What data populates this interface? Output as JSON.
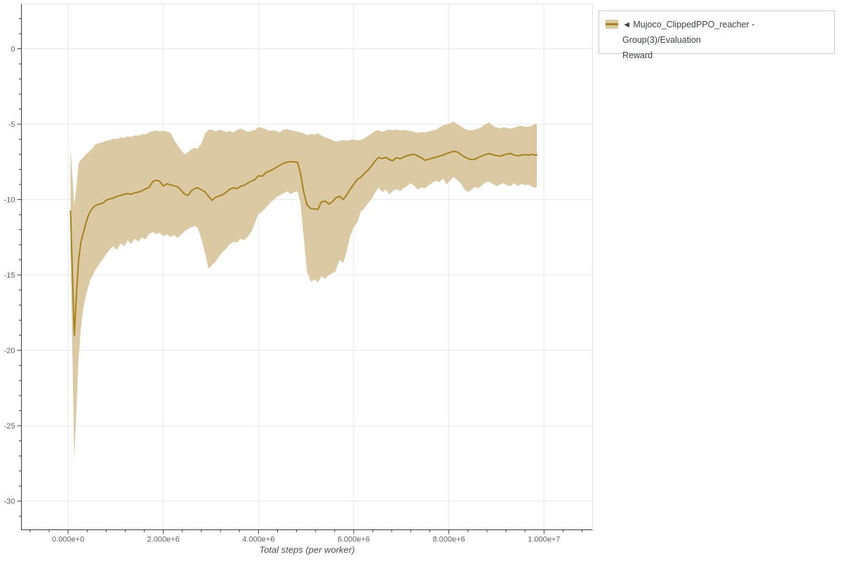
{
  "page": {
    "background": "#ffffff"
  },
  "legend": {
    "marker": "◄",
    "label_line1": "Mujoco_ClippedPPO_reacher - Group(3)/Evaluation",
    "label_line2": "Reward",
    "series_color": "#a9801e",
    "band_color": "#dac9a3",
    "border_color": "#c9c9c9"
  },
  "chart_data": {
    "type": "line",
    "title": "",
    "xlabel": "Total steps (per worker)",
    "ylabel": "",
    "x_unit": "steps",
    "xlim": [
      -982000,
      11020000
    ],
    "ylim": [
      -31.9,
      2.98
    ],
    "grid": "major",
    "legend_position": "outside-top-right",
    "x_ticks": {
      "values": [
        0,
        2000000,
        4000000,
        6000000,
        8000000,
        10000000
      ],
      "labels": [
        "0.000e+0",
        "2.000e+6",
        "4.000e+6",
        "6.000e+6",
        "8.000e+6",
        "1.000e+7"
      ],
      "minor_step": 400000
    },
    "y_ticks": {
      "values": [
        0,
        -5,
        -10,
        -15,
        -20,
        -25,
        -30
      ],
      "labels": [
        "0",
        "-5",
        "-10",
        "-15",
        "-20",
        "-25",
        "-30"
      ],
      "minor_step": 1
    },
    "style": {
      "grid_color": "#e7e7e7",
      "frame_outline_color": "#e5e5e5",
      "axis_color": "#3a3a3a",
      "tick_label_color": "#5f5f5f",
      "axis_label_color": "#4d4d4d"
    },
    "series": [
      {
        "name": "Mujoco_ClippedPPO_reacher - Group(3)/Evaluation Reward",
        "type": "line-with-band",
        "color": "#a9801e",
        "band_color": "#dac9a3",
        "x_scale_to_steps": 1000000,
        "x_millions": [
          0.05,
          0.13,
          0.18,
          0.22,
          0.27,
          0.32,
          0.37,
          0.42,
          0.47,
          0.52,
          0.57,
          0.65,
          0.72,
          0.8,
          0.88,
          0.95,
          1.02,
          1.1,
          1.18,
          1.25,
          1.32,
          1.4,
          1.48,
          1.55,
          1.62,
          1.7,
          1.78,
          1.85,
          1.92,
          2.0,
          2.08,
          2.15,
          2.22,
          2.3,
          2.38,
          2.45,
          2.52,
          2.58,
          2.65,
          2.72,
          2.8,
          2.88,
          2.95,
          3.02,
          3.1,
          3.18,
          3.25,
          3.32,
          3.4,
          3.48,
          3.55,
          3.62,
          3.7,
          3.78,
          3.85,
          3.92,
          4.0,
          4.08,
          4.15,
          4.22,
          4.3,
          4.38,
          4.45,
          4.52,
          4.6,
          4.68,
          4.75,
          4.82,
          4.88,
          4.95,
          5.02,
          5.1,
          5.18,
          5.25,
          5.32,
          5.4,
          5.48,
          5.55,
          5.62,
          5.7,
          5.78,
          5.85,
          5.92,
          6.0,
          6.08,
          6.15,
          6.22,
          6.3,
          6.38,
          6.45,
          6.52,
          6.6,
          6.68,
          6.75,
          6.82,
          6.9,
          6.98,
          7.05,
          7.12,
          7.2,
          7.28,
          7.35,
          7.42,
          7.5,
          7.58,
          7.65,
          7.72,
          7.8,
          7.88,
          7.95,
          8.02,
          8.1,
          8.18,
          8.25,
          8.32,
          8.4,
          8.48,
          8.55,
          8.62,
          8.7,
          8.78,
          8.85,
          8.92,
          9.0,
          9.08,
          9.15,
          9.22,
          9.3,
          9.38,
          9.45,
          9.52,
          9.6,
          9.68,
          9.75,
          9.82,
          9.85
        ],
        "mean": [
          -10.75,
          -19.0,
          -16.0,
          -14.0,
          -12.8,
          -12.2,
          -11.6,
          -11.1,
          -10.75,
          -10.55,
          -10.4,
          -10.3,
          -10.25,
          -10.05,
          -9.95,
          -9.9,
          -9.8,
          -9.72,
          -9.65,
          -9.6,
          -9.65,
          -9.55,
          -9.5,
          -9.42,
          -9.3,
          -9.2,
          -8.8,
          -8.72,
          -8.78,
          -9.1,
          -8.95,
          -9.02,
          -9.08,
          -9.15,
          -9.4,
          -9.65,
          -9.72,
          -9.45,
          -9.28,
          -9.22,
          -9.35,
          -9.5,
          -9.78,
          -10.05,
          -9.85,
          -9.75,
          -9.68,
          -9.52,
          -9.3,
          -9.22,
          -9.28,
          -9.12,
          -9.05,
          -8.9,
          -8.78,
          -8.68,
          -8.42,
          -8.45,
          -8.22,
          -8.12,
          -8.0,
          -7.85,
          -7.72,
          -7.6,
          -7.52,
          -7.48,
          -7.5,
          -7.52,
          -8.2,
          -9.5,
          -10.35,
          -10.6,
          -10.62,
          -10.65,
          -10.15,
          -10.1,
          -10.3,
          -10.15,
          -9.9,
          -9.78,
          -10.0,
          -9.7,
          -9.35,
          -9.0,
          -8.65,
          -8.52,
          -8.28,
          -8.05,
          -7.75,
          -7.45,
          -7.2,
          -7.28,
          -7.2,
          -7.35,
          -7.42,
          -7.22,
          -7.3,
          -7.18,
          -7.1,
          -7.02,
          -7.0,
          -7.12,
          -7.22,
          -7.4,
          -7.32,
          -7.25,
          -7.2,
          -7.12,
          -7.05,
          -6.95,
          -6.88,
          -6.8,
          -6.85,
          -7.0,
          -7.15,
          -7.28,
          -7.35,
          -7.32,
          -7.2,
          -7.1,
          -7.0,
          -6.95,
          -7.02,
          -7.08,
          -7.12,
          -7.05,
          -6.98,
          -6.95,
          -7.05,
          -7.1,
          -7.05,
          -7.02,
          -7.06,
          -7.0,
          -7.05,
          -7.05
        ],
        "band_upper": [
          -6.5,
          -10.4,
          -9.0,
          -7.6,
          -7.35,
          -7.2,
          -7.0,
          -6.9,
          -6.7,
          -6.6,
          -6.35,
          -6.25,
          -6.2,
          -6.1,
          -6.05,
          -5.95,
          -6.0,
          -5.88,
          -5.92,
          -5.8,
          -5.85,
          -5.72,
          -5.78,
          -5.65,
          -5.68,
          -5.55,
          -5.45,
          -5.42,
          -5.48,
          -5.42,
          -5.5,
          -5.58,
          -6.0,
          -6.4,
          -6.75,
          -7.0,
          -6.85,
          -6.68,
          -6.58,
          -6.62,
          -6.3,
          -5.6,
          -5.38,
          -5.35,
          -5.5,
          -5.35,
          -5.42,
          -5.52,
          -5.45,
          -5.55,
          -5.38,
          -5.28,
          -5.4,
          -5.52,
          -5.45,
          -5.4,
          -5.18,
          -5.25,
          -5.32,
          -5.45,
          -5.4,
          -5.45,
          -5.55,
          -5.38,
          -5.32,
          -5.4,
          -5.45,
          -5.5,
          -5.55,
          -5.6,
          -5.72,
          -5.65,
          -5.68,
          -5.6,
          -5.75,
          -5.88,
          -5.95,
          -6.05,
          -6.15,
          -6.1,
          -6.05,
          -6.1,
          -6.05,
          -6.02,
          -6.08,
          -6.05,
          -5.95,
          -5.78,
          -5.6,
          -5.45,
          -5.4,
          -5.5,
          -5.42,
          -5.35,
          -5.4,
          -5.35,
          -5.42,
          -5.38,
          -5.42,
          -5.45,
          -5.52,
          -5.58,
          -5.52,
          -5.55,
          -5.48,
          -5.42,
          -5.38,
          -5.22,
          -5.08,
          -5.02,
          -4.95,
          -4.82,
          -5.0,
          -5.12,
          -5.3,
          -5.38,
          -5.42,
          -5.35,
          -5.3,
          -5.15,
          -4.98,
          -4.88,
          -5.1,
          -5.22,
          -5.28,
          -5.2,
          -5.25,
          -5.3,
          -5.22,
          -5.15,
          -5.1,
          -5.18,
          -5.15,
          -5.1,
          -4.95,
          -5.0
        ],
        "band_lower": [
          -13.5,
          -27.3,
          -23.5,
          -20.5,
          -18.5,
          -17.2,
          -16.4,
          -15.8,
          -15.3,
          -15.0,
          -14.7,
          -14.3,
          -14.0,
          -13.6,
          -13.3,
          -13.1,
          -13.35,
          -12.9,
          -13.1,
          -12.7,
          -12.95,
          -12.6,
          -12.8,
          -12.5,
          -12.65,
          -12.3,
          -12.15,
          -12.3,
          -12.2,
          -12.45,
          -12.3,
          -12.5,
          -12.35,
          -12.55,
          -12.3,
          -12.1,
          -11.95,
          -11.85,
          -11.75,
          -11.85,
          -12.6,
          -13.6,
          -14.6,
          -14.35,
          -14.1,
          -13.75,
          -13.45,
          -13.25,
          -12.95,
          -12.8,
          -12.85,
          -12.6,
          -12.7,
          -12.45,
          -12.15,
          -11.6,
          -10.95,
          -10.8,
          -10.55,
          -10.3,
          -10.05,
          -9.85,
          -9.7,
          -9.6,
          -9.45,
          -9.65,
          -9.5,
          -9.45,
          -10.2,
          -12.5,
          -14.8,
          -15.45,
          -15.3,
          -15.5,
          -15.1,
          -15.25,
          -15.0,
          -14.9,
          -14.75,
          -14.0,
          -14.2,
          -13.5,
          -12.5,
          -11.85,
          -11.5,
          -10.8,
          -10.6,
          -10.25,
          -9.95,
          -9.55,
          -9.2,
          -9.5,
          -9.35,
          -9.65,
          -9.45,
          -9.3,
          -9.45,
          -9.25,
          -9.1,
          -8.9,
          -9.12,
          -9.35,
          -9.2,
          -9.25,
          -9.05,
          -8.9,
          -8.75,
          -8.85,
          -8.6,
          -9.0,
          -8.75,
          -8.5,
          -8.72,
          -8.9,
          -9.3,
          -9.5,
          -9.35,
          -9.15,
          -9.25,
          -9.05,
          -8.85,
          -8.8,
          -8.95,
          -9.1,
          -9.0,
          -8.9,
          -9.05,
          -9.1,
          -8.9,
          -9.12,
          -8.95,
          -9.05,
          -9.0,
          -9.15,
          -9.2,
          -9.15
        ]
      }
    ]
  }
}
